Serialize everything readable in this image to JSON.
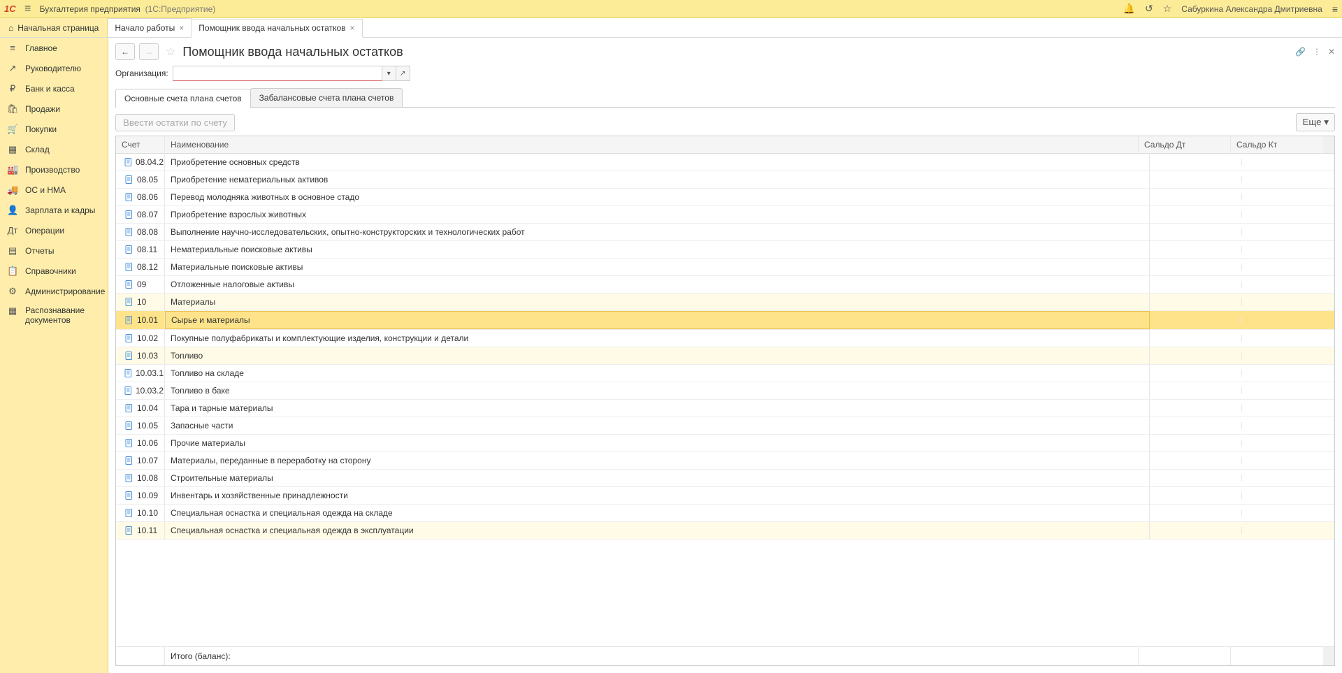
{
  "titlebar": {
    "app_name": "Бухгалтерия предприятия",
    "system": "(1С:Предприятие)",
    "username": "Сабуркина Александра Дмитриевна"
  },
  "tabs": {
    "home": "Начальная страница",
    "t1": "Начало работы",
    "t2": "Помощник ввода начальных остатков"
  },
  "sidebar": {
    "items": [
      {
        "icon": "≡",
        "label": "Главное"
      },
      {
        "icon": "↗",
        "label": "Руководителю"
      },
      {
        "icon": "₽",
        "label": "Банк и касса"
      },
      {
        "icon": "🛍",
        "label": "Продажи"
      },
      {
        "icon": "🛒",
        "label": "Покупки"
      },
      {
        "icon": "▦",
        "label": "Склад"
      },
      {
        "icon": "🏭",
        "label": "Производство"
      },
      {
        "icon": "🚚",
        "label": "ОС и НМА"
      },
      {
        "icon": "👤",
        "label": "Зарплата и кадры"
      },
      {
        "icon": "Дт",
        "label": "Операции"
      },
      {
        "icon": "▤",
        "label": "Отчеты"
      },
      {
        "icon": "📋",
        "label": "Справочники"
      },
      {
        "icon": "⚙",
        "label": "Администрирование"
      },
      {
        "icon": "▦",
        "label": "Распознавание документов"
      }
    ]
  },
  "page": {
    "title": "Помощник ввода начальных остатков",
    "org_label": "Организация:"
  },
  "inner_tabs": {
    "t1": "Основные счета плана счетов",
    "t2": "Забалансовые счета плана счетов"
  },
  "buttons": {
    "vvesti": "Ввести остатки по счету",
    "more": "Еще"
  },
  "table": {
    "headers": {
      "sc": "Счет",
      "nm": "Наименование",
      "dt": "Сальдо Дт",
      "kt": "Сальдо Кт"
    },
    "footer": "Итого (баланс):",
    "rows": [
      {
        "sc": "08.04.2",
        "nm": "Приобретение основных средств",
        "g": false
      },
      {
        "sc": "08.05",
        "nm": "Приобретение нематериальных активов",
        "g": false
      },
      {
        "sc": "08.06",
        "nm": "Перевод молодняка животных в основное стадо",
        "g": false
      },
      {
        "sc": "08.07",
        "nm": "Приобретение взрослых животных",
        "g": false
      },
      {
        "sc": "08.08",
        "nm": "Выполнение научно-исследовательских, опытно-конструкторских и технологических работ",
        "g": false
      },
      {
        "sc": "08.11",
        "nm": "Нематериальные поисковые активы",
        "g": false
      },
      {
        "sc": "08.12",
        "nm": "Материальные поисковые активы",
        "g": false
      },
      {
        "sc": "09",
        "nm": "Отложенные налоговые активы",
        "g": false
      },
      {
        "sc": "10",
        "nm": "Материалы",
        "g": true
      },
      {
        "sc": "10.01",
        "nm": "Сырье и материалы",
        "g": true,
        "sel": true
      },
      {
        "sc": "10.02",
        "nm": "Покупные полуфабрикаты и комплектующие изделия, конструкции и детали",
        "g": false
      },
      {
        "sc": "10.03",
        "nm": "Топливо",
        "g": true
      },
      {
        "sc": "10.03.1",
        "nm": "Топливо на складе",
        "g": false
      },
      {
        "sc": "10.03.2",
        "nm": "Топливо в баке",
        "g": false
      },
      {
        "sc": "10.04",
        "nm": "Тара и тарные материалы",
        "g": false
      },
      {
        "sc": "10.05",
        "nm": "Запасные части",
        "g": false
      },
      {
        "sc": "10.06",
        "nm": "Прочие материалы",
        "g": false
      },
      {
        "sc": "10.07",
        "nm": "Материалы, переданные в переработку на сторону",
        "g": false
      },
      {
        "sc": "10.08",
        "nm": "Строительные материалы",
        "g": false
      },
      {
        "sc": "10.09",
        "nm": "Инвентарь и хозяйственные принадлежности",
        "g": false
      },
      {
        "sc": "10.10",
        "nm": "Специальная оснастка и специальная одежда на складе",
        "g": false
      },
      {
        "sc": "10.11",
        "nm": "Специальная оснастка и специальная одежда в эксплуатации",
        "g": true
      }
    ]
  }
}
